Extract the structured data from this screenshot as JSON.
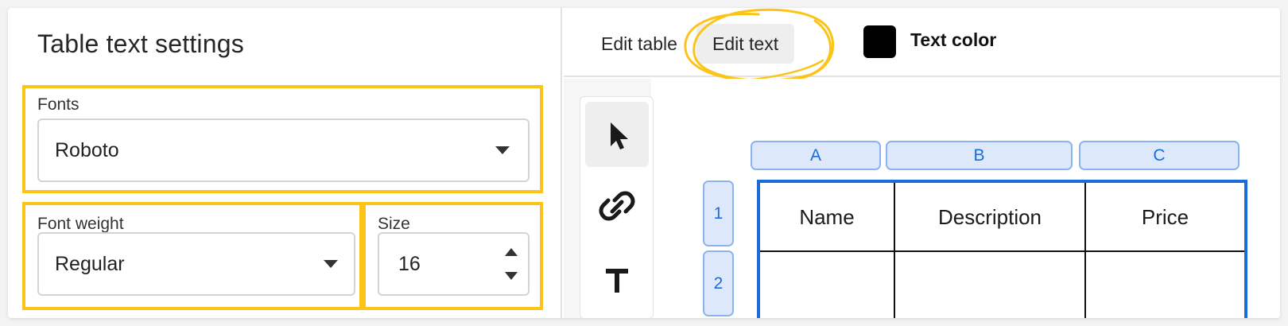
{
  "left_panel": {
    "title": "Table text settings",
    "fonts": {
      "label": "Fonts",
      "value": "Roboto"
    },
    "font_weight": {
      "label": "Font weight",
      "value": "Regular"
    },
    "size": {
      "label": "Size",
      "value": "16"
    }
  },
  "toolbar": {
    "edit_table_label": "Edit table",
    "edit_text_label": "Edit text",
    "active_tab": "Edit text",
    "text_color_label": "Text color",
    "text_color_value": "#000000"
  },
  "tools": [
    {
      "name": "pointer",
      "icon": "cursor-arrow-icon",
      "active": true
    },
    {
      "name": "link",
      "icon": "link-icon",
      "active": false
    },
    {
      "name": "text",
      "icon": "text-T-icon",
      "active": false
    }
  ],
  "table": {
    "columns": [
      "A",
      "B",
      "C"
    ],
    "rows": [
      "1",
      "2"
    ],
    "cells": [
      [
        "Name",
        "Description",
        "Price"
      ],
      [
        "",
        "",
        ""
      ]
    ]
  },
  "colors": {
    "highlight": "#fcc419",
    "selection": "#1a6cdc",
    "header_fill": "#dde9fb"
  }
}
